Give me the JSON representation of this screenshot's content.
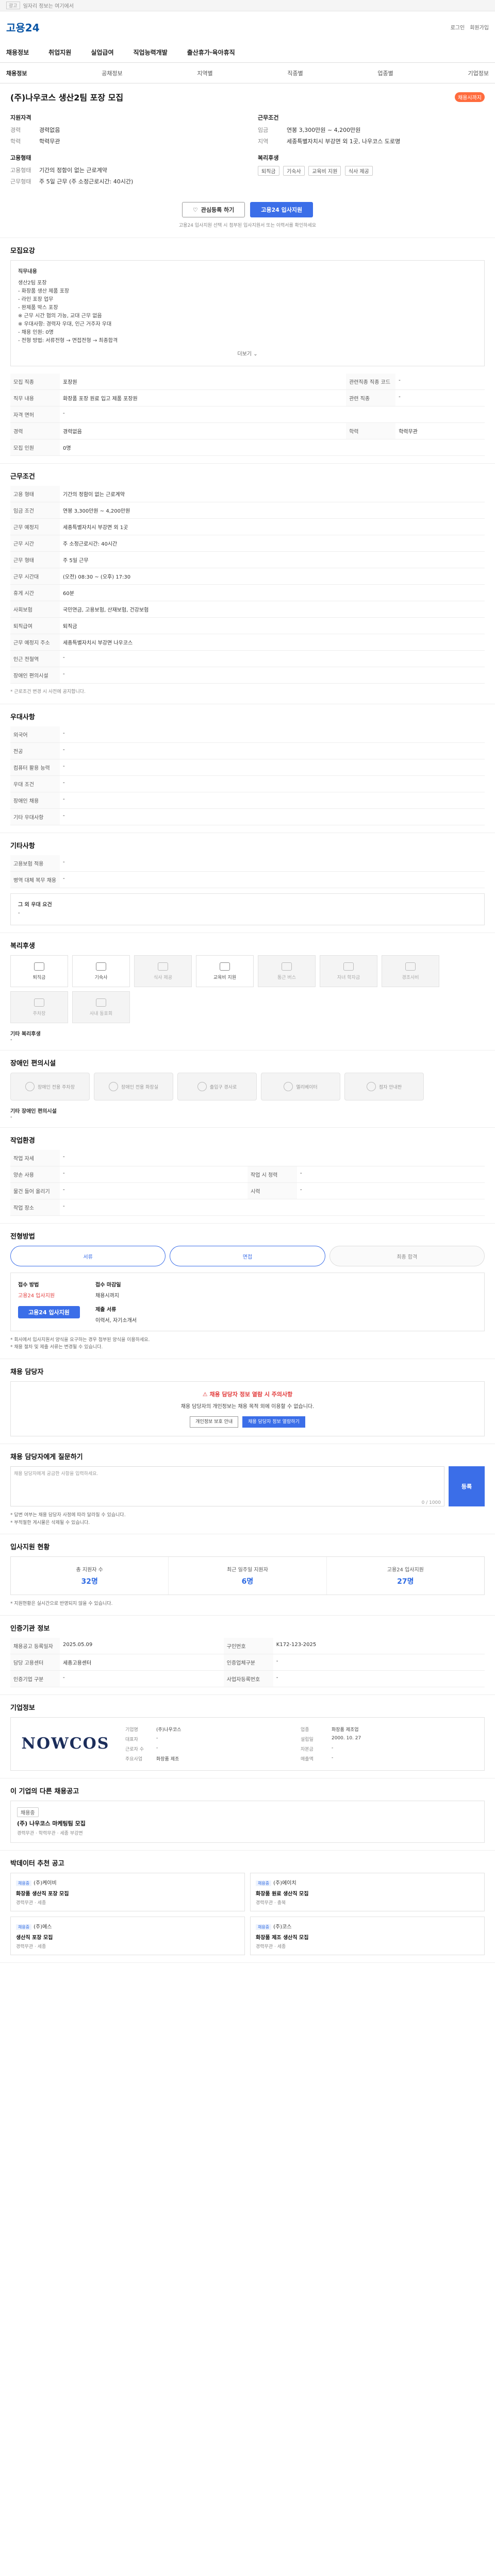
{
  "topbar": {
    "ad": "광고",
    "text": "일자리 정보는 여기에서"
  },
  "header": {
    "logo": "고용24",
    "util": [
      "로그인",
      "회원가입"
    ]
  },
  "nav": [
    "채용정보",
    "취업지원",
    "실업급여",
    "직업능력개발",
    "출산휴가·육아휴직"
  ],
  "subnav": {
    "left": "채용정보",
    "items": [
      "공채정보",
      "지역별",
      "직종별",
      "업종별",
      "기업정보"
    ]
  },
  "job": {
    "title": "(주)나우코스 생산2팀 포장 모집",
    "status": "채용시까지",
    "recruit": {
      "heading": "지원자격",
      "rows": [
        {
          "k": "경력",
          "v": "경력없음"
        },
        {
          "k": "학력",
          "v": "학력무관"
        }
      ]
    },
    "work": {
      "heading": "근무조건",
      "rows": [
        {
          "k": "임금",
          "v": "연봉 3,300만원 ~ 4,200만원"
        },
        {
          "k": "지역",
          "v": "세종특별자치시 부강면 외 1곳, 나우코스 도로명"
        }
      ]
    },
    "employ": {
      "heading": "고용형태",
      "rows": [
        {
          "k": "고용형태",
          "v": "기간의 정함이 없는 근로계약"
        },
        {
          "k": "근무형태",
          "v": "주 5일 근무 (주 소정근로시간: 40시간)"
        }
      ]
    },
    "welfare": {
      "heading": "복리후생",
      "chips": [
        "퇴직금",
        "기숙사",
        "교육비 지원",
        "식사 제공"
      ]
    },
    "buttons": {
      "scrap": "관심등록 하기",
      "apply": "고용24 입사지원"
    },
    "notice": "고용24 입사지원 선택 시 첨부된 입사지원서 또는 이력서를 확인하세요"
  },
  "detail": {
    "heading": "모집요강",
    "box_title": "직무내용",
    "lines": [
      "생산2팀 포장",
      "- 화장품 생산 제품 포장",
      "- 라인 포장 업무",
      "- 완제품 박스 포장",
      "※ 근무 시간 협의 가능, 교대 근무 없음",
      "※ 우대사항: 경력자 우대, 인근 거주자 우대",
      "- 채용 인원: 0명",
      "- 전형 방법: 서류전형 → 면접전형 → 최종합격"
    ],
    "more": "더보기"
  },
  "summary_table": [
    {
      "k": "모집 직종",
      "v": "포장원",
      "k2": "관련직종 직종 코드",
      "v2": "-"
    },
    {
      "k": "직무 내용",
      "v": "화장품 포장 원료 입고 제품 포장원",
      "k2": "관련 직종",
      "v2": "-"
    },
    {
      "k": "자격 면허",
      "v": "-",
      "k2": "",
      "v2": ""
    },
    {
      "k": "경력",
      "v": "경력없음",
      "k2": "학력",
      "v2": "학력무관"
    },
    {
      "k": "모집 인원",
      "v": "0명",
      "k2": "",
      "v2": ""
    }
  ],
  "conditions": {
    "heading": "근무조건",
    "rows": [
      {
        "k": "고용 형태",
        "v": "기간의 정함이 없는 근로계약"
      },
      {
        "k": "임금 조건",
        "v": "연봉 3,300만원 ~ 4,200만원"
      },
      {
        "k": "근무 예정지",
        "v": "세종특별자치시 부강면 외 1곳"
      },
      {
        "k": "근무 시간",
        "v": "주 소정근로시간: 40시간"
      },
      {
        "k": "근무 형태",
        "v": "주 5일 근무"
      },
      {
        "k": "근무 시간대",
        "v": "(오전) 08:30 ~ (오후) 17:30"
      },
      {
        "k": "휴게 시간",
        "v": "60분"
      },
      {
        "k": "사회보험",
        "v": "국민연금, 고용보험, 산재보험, 건강보험"
      },
      {
        "k": "퇴직급여",
        "v": "퇴직금"
      },
      {
        "k": "근무 예정지 주소",
        "v": "세종특별자치시 부강면 나우코스"
      },
      {
        "k": "인근 전철역",
        "v": "-"
      },
      {
        "k": "장애인 편의시설",
        "v": "-"
      }
    ],
    "note": "* 근로조건 변경 시 사전에 공지합니다."
  },
  "preferred": {
    "heading": "우대사항",
    "rows": [
      {
        "k": "외국어",
        "v": "-"
      },
      {
        "k": "전공",
        "v": "-"
      },
      {
        "k": "컴퓨터 활용 능력",
        "v": "-"
      },
      {
        "k": "우대 조건",
        "v": "-"
      },
      {
        "k": "장애인 채용",
        "v": "-"
      },
      {
        "k": "기타 우대사항",
        "v": "-"
      }
    ]
  },
  "misc": {
    "heading": "기타사항",
    "rows": [
      {
        "k": "고용보험 적용",
        "v": "-"
      },
      {
        "k": "병역 대체 복무 채용",
        "v": "-"
      }
    ],
    "extra_title": "그 외 우대 요건",
    "extra_value": "-"
  },
  "benefits": {
    "heading": "복리후생",
    "tiles": [
      {
        "label": "퇴직금",
        "on": true
      },
      {
        "label": "기숙사",
        "on": true
      },
      {
        "label": "식사 제공",
        "on": false
      },
      {
        "label": "교육비 지원",
        "on": true
      },
      {
        "label": "통근 버스",
        "on": false
      },
      {
        "label": "자녀 학자금",
        "on": false
      },
      {
        "label": "경조사비",
        "on": false
      },
      {
        "label": "주차장",
        "on": false
      },
      {
        "label": "사내 동호회",
        "on": false
      }
    ],
    "extra_title": "기타 복리후생",
    "extra_value": "-"
  },
  "facilities": {
    "heading": "장애인 편의시설",
    "tiles": [
      "장애인 전용 주차장",
      "장애인 전용 화장실",
      "출입구 경사로",
      "엘리베이터",
      "점자 안내판"
    ],
    "extra_title": "기타 장애인 편의시설",
    "extra_value": "-"
  },
  "environment": {
    "heading": "작업환경",
    "rows": [
      {
        "k": "작업 자세",
        "v": "-",
        "k2": "",
        "v2": ""
      },
      {
        "k": "양손 사용",
        "v": "-",
        "k2": "작업 시 청력",
        "v2": "-"
      },
      {
        "k": "물건 들어 올리기",
        "v": "-",
        "k2": "시력",
        "v2": "-"
      },
      {
        "k": "작업 장소",
        "v": "-",
        "k2": "",
        "v2": ""
      }
    ]
  },
  "process": {
    "heading": "전형방법",
    "tabs": [
      "서류",
      "면접",
      "최종 합격"
    ],
    "apply_title": "접수 방법",
    "apply_value": "고용24 입사지원",
    "deadline_title": "접수 마감일",
    "deadline_value": "채용시까지",
    "docs_title": "제출 서류",
    "docs_value": "이력서, 자기소개서",
    "apply_btn": "고용24 입사지원",
    "notes": [
      "* 회사에서 입사지원서 양식을 요구하는 경우 첨부된 양식을 이용하세요.",
      "* 채용 절차 및 제출 서류는 변경될 수 있습니다."
    ]
  },
  "contact": {
    "heading": "채용 담당자",
    "warn_title": "채용 담당자 정보 열람 시 주의사항",
    "warn_text": "채용 담당자의 개인정보는 채용 목적 외에 이용할 수 없습니다.",
    "btn1": "개인정보 보호 안내",
    "btn2": "채용 담당자 정보 열람하기"
  },
  "qa": {
    "heading": "채용 담당자에게 질문하기",
    "placeholder": "채용 담당자에게 궁금한 사항을 입력하세요.",
    "counter": "0 / 1000",
    "send": "등록",
    "notes": [
      "* 답변 여부는 채용 담당자 사정에 따라 달라질 수 있습니다.",
      "* 부적절한 게시물은 삭제될 수 있습니다."
    ]
  },
  "stats": {
    "heading": "입사지원 현황",
    "items": [
      {
        "label": "총 지원자 수",
        "value": "32명"
      },
      {
        "label": "최근 일주일 지원자",
        "value": "6명"
      },
      {
        "label": "고용24 입사지원",
        "value": "27명"
      }
    ],
    "note": "* 지원현황은 실시간으로 반영되지 않을 수 있습니다."
  },
  "manage": {
    "heading": "인증기관 정보",
    "rows": [
      {
        "k": "채용공고 등록일자",
        "v": "2025.05.09",
        "k2": "구인번호",
        "v2": "K172-123-2025"
      },
      {
        "k": "담당 고용센터",
        "v": "세종고용센터",
        "k2": "인증업체구분",
        "v2": "-"
      },
      {
        "k": "인증기업 구분",
        "v": "-",
        "k2": "사업자등록번호",
        "v2": "-"
      }
    ]
  },
  "company": {
    "heading": "기업정보",
    "logo": "NOWCOS",
    "fields": [
      {
        "k": "기업명",
        "v": "(주)나우코스"
      },
      {
        "k": "업종",
        "v": "화장품 제조업"
      },
      {
        "k": "대표자",
        "v": "-"
      },
      {
        "k": "설립일",
        "v": "2000. 10. 27"
      },
      {
        "k": "근로자 수",
        "v": "-"
      },
      {
        "k": "자본금",
        "v": "-"
      },
      {
        "k": "주요사업",
        "v": "화장품 제조"
      },
      {
        "k": "매출액",
        "v": "-"
      }
    ]
  },
  "related": {
    "heading": "이 기업의 다른 채용공고",
    "badge": "채용중",
    "title": "(주) 나우코스 마케팅팀 모집",
    "meta": "경력무관 · 학력무관 · 세종 부강면"
  },
  "similar": {
    "heading": "박데이터 추천 공고",
    "cards": [
      {
        "badge": "채용중",
        "company": "(주)케이비",
        "title": "화장품 생산직 포장 모집",
        "meta": "경력무관 · 세종"
      },
      {
        "badge": "채용중",
        "company": "(주)에이치",
        "title": "화장품 원료 생산직 모집",
        "meta": "경력무관 · 충북"
      },
      {
        "badge": "채용중",
        "company": "(주)에스",
        "title": "생산직 포장 모집",
        "meta": "경력무관 · 세종"
      },
      {
        "badge": "채용중",
        "company": "(주)코스",
        "title": "화장품 제조 생산직 모집",
        "meta": "경력무관 · 세종"
      }
    ]
  }
}
